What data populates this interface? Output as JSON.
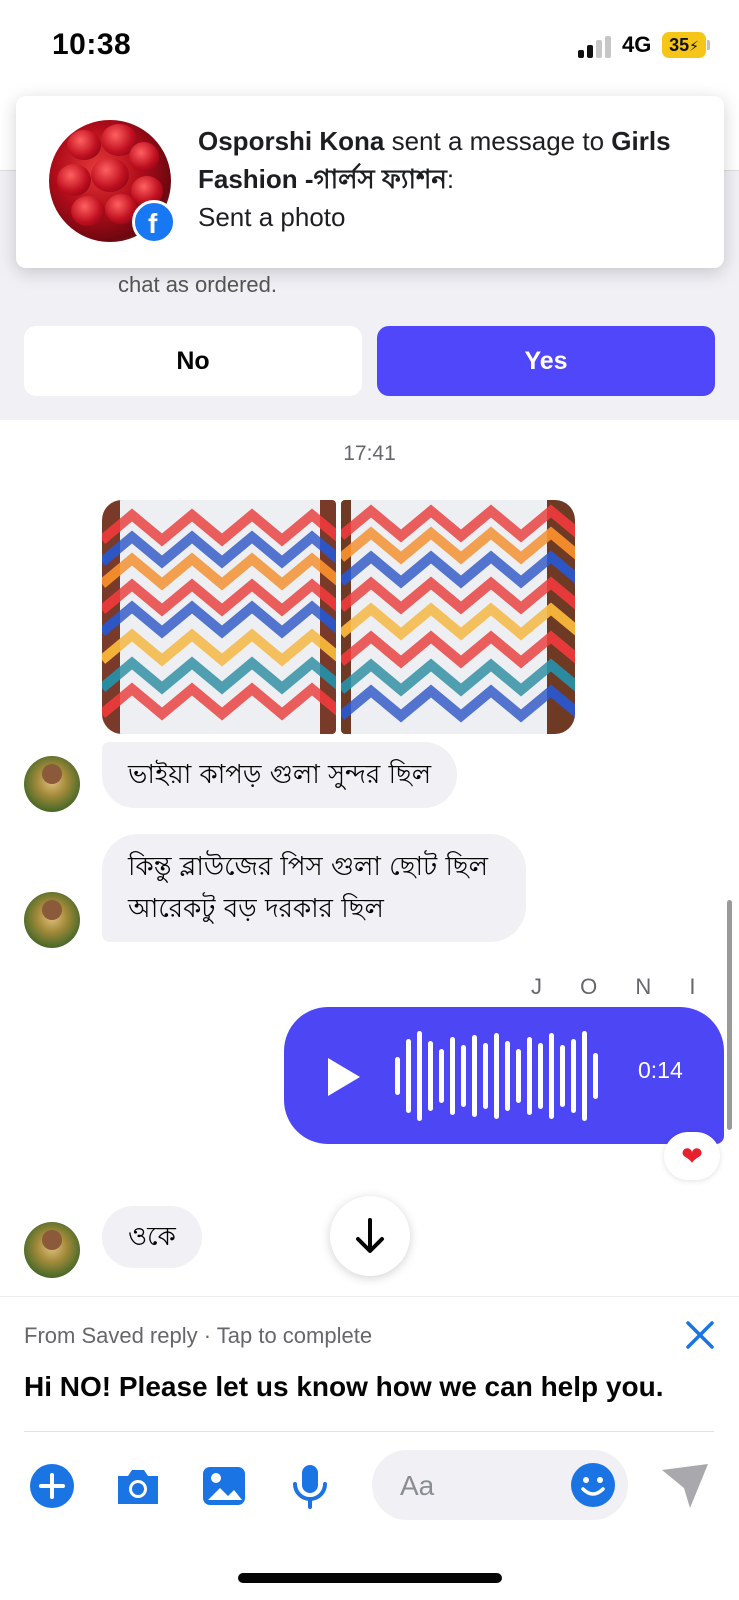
{
  "status_bar": {
    "time": "10:38",
    "network": "4G",
    "battery": "35"
  },
  "notification": {
    "sender": "Osporshi Kona",
    "action": "sent a message to",
    "page": "Girls Fashion  -গার্লস ফ্যাশন",
    "body": "Sent a photo"
  },
  "order_prompt": {
    "text": "chat as ordered.",
    "no_label": "No",
    "yes_label": "Yes",
    "yes_color": "#5046fa"
  },
  "chat": {
    "timestamp": "17:41",
    "messages": [
      {
        "text": "ভাইয়া কাপড় গুলা সুন্দর ছিল"
      },
      {
        "line1": "কিন্তু ব্লাউজের পিস গুলা ছোট ছিল",
        "line2": "আরেকটু বড় দরকার ছিল"
      },
      {
        "text": "ওকে"
      }
    ],
    "sender_name": "J O N I ツ",
    "voice_message": {
      "duration": "0:14",
      "color": "#4c46f5",
      "reaction": "❤"
    }
  },
  "saved_reply": {
    "hint": "From Saved reply · Tap to complete",
    "text": "Hi NO! Please let us know how we can help you."
  },
  "composer": {
    "placeholder": "Aa",
    "icons": [
      "plus-icon",
      "camera-icon",
      "gallery-icon",
      "microphone-icon",
      "emoji-icon",
      "send-icon"
    ],
    "accent": "#1b74e4"
  }
}
